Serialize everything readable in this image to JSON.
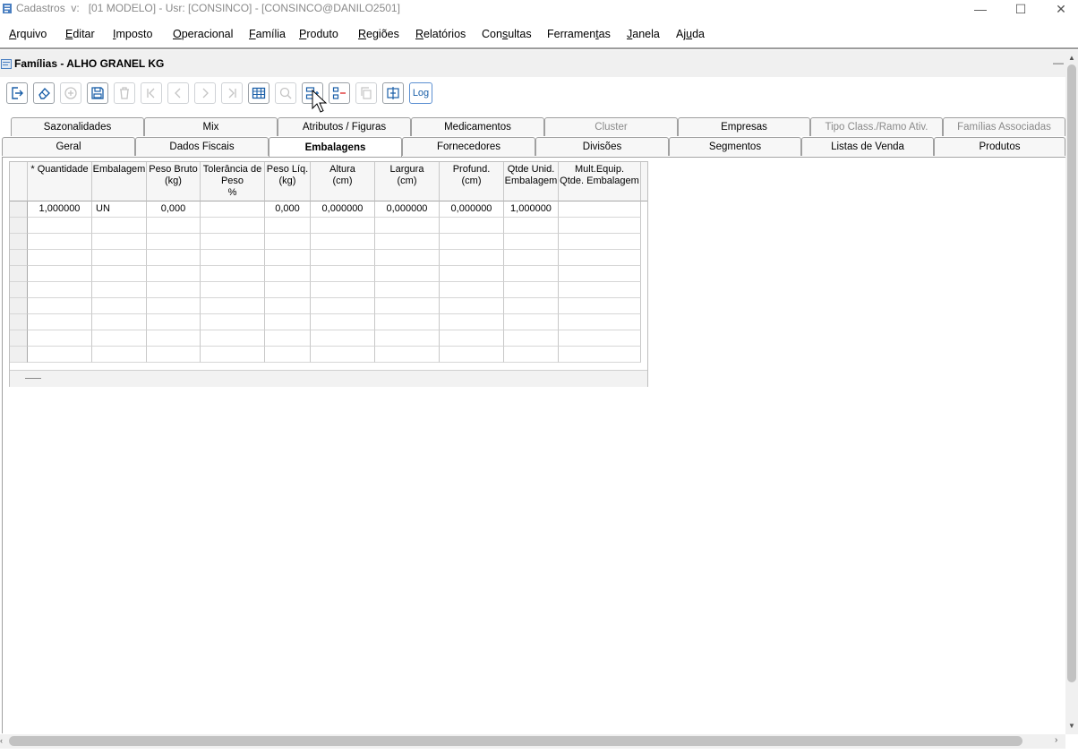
{
  "window": {
    "title": "Cadastros  v:   [01 MODELO] - Usr: [CONSINCO] - [CONSINCO@DANILO2501]",
    "minimize": "—",
    "maximize": "☐",
    "close": "✕"
  },
  "menu": {
    "items": [
      {
        "pre": "",
        "u": "A",
        "post": "rquivo"
      },
      {
        "pre": "",
        "u": "E",
        "post": "ditar"
      },
      {
        "pre": "",
        "u": "I",
        "post": "mposto"
      },
      {
        "pre": "",
        "u": "O",
        "post": "peracional"
      },
      {
        "pre": "",
        "u": "F",
        "post": "amília"
      },
      {
        "pre": "",
        "u": "P",
        "post": "roduto"
      },
      {
        "pre": "",
        "u": "R",
        "post": "egiões"
      },
      {
        "pre": "",
        "u": "R",
        "post": "elatórios"
      },
      {
        "pre": "Con",
        "u": "s",
        "post": "ultas"
      },
      {
        "pre": "Ferramen",
        "u": "t",
        "post": "as"
      },
      {
        "pre": "",
        "u": "J",
        "post": "anela"
      },
      {
        "pre": "Aj",
        "u": "u",
        "post": "da"
      }
    ]
  },
  "child": {
    "title": "Famílias - ALHO GRANEL KG",
    "minimize": "—"
  },
  "toolbar": {
    "log_label": "Log"
  },
  "tabs": {
    "row1": [
      "Sazonalidades",
      "Mix",
      "Atributos / Figuras",
      "Medicamentos",
      "Cluster",
      "Empresas",
      "Tipo Class./Ramo Ativ.",
      "Famílias Associadas"
    ],
    "row2": [
      "Geral",
      "Dados Fiscais",
      "Embalagens",
      "Fornecedores",
      "Divisões",
      "Segmentos",
      "Listas de Venda",
      "Produtos"
    ],
    "active": "Embalagens"
  },
  "grid": {
    "columns": [
      {
        "l1": "* Quantidade",
        "l2": "",
        "l3": ""
      },
      {
        "l1": "Embalagem",
        "l2": "",
        "l3": ""
      },
      {
        "l1": "Peso Bruto",
        "l2": "(kg)",
        "l3": ""
      },
      {
        "l1": "Tolerância de",
        "l2": "Peso",
        "l3": "%"
      },
      {
        "l1": "Peso Líq.",
        "l2": "(kg)",
        "l3": ""
      },
      {
        "l1": "Altura",
        "l2": "(cm)",
        "l3": ""
      },
      {
        "l1": "Largura",
        "l2": "(cm)",
        "l3": ""
      },
      {
        "l1": "Profund.",
        "l2": "(cm)",
        "l3": ""
      },
      {
        "l1": "Qtde Unid.",
        "l2": "Embalagem",
        "l3": ""
      },
      {
        "l1": "Mult.Equip.",
        "l2": "Qtde. Embalagem",
        "l3": ""
      }
    ],
    "rows": [
      [
        "1,000000",
        "UN",
        "0,000",
        "",
        "0,000",
        "0,000000",
        "0,000000",
        "0,000000",
        "1,000000",
        ""
      ]
    ]
  },
  "colors": {
    "accent": "#1a73c7",
    "border": "#a0a0a0"
  }
}
